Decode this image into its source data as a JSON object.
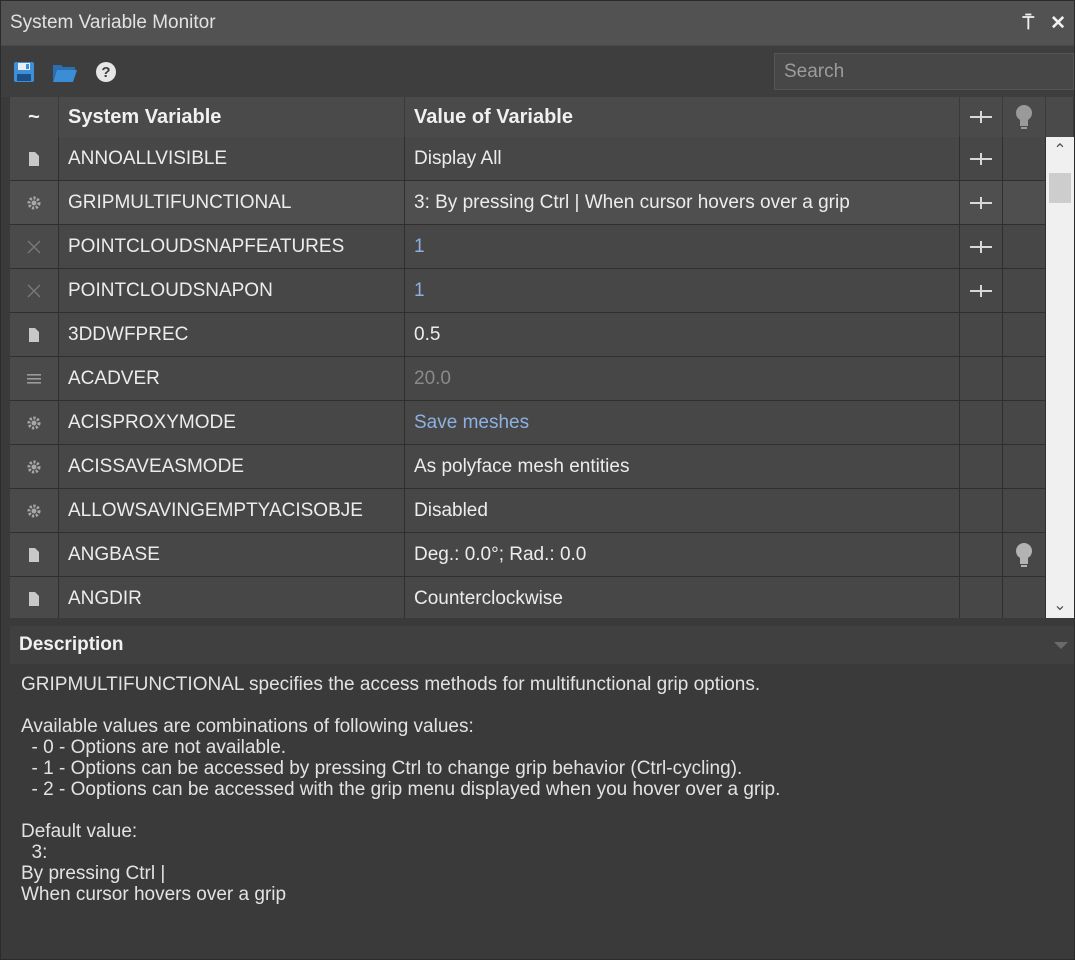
{
  "window": {
    "title": "System Variable Monitor",
    "pin_glyph": "⍑",
    "close_glyph": "✕"
  },
  "toolbar": {
    "icons": [
      "save-icon",
      "open-folder-icon",
      "help-icon"
    ],
    "search_placeholder": "Search"
  },
  "table": {
    "headers": {
      "type": "~",
      "name": "System Variable",
      "value": "Value of Variable"
    },
    "rows": [
      {
        "icon": "document-icon",
        "name": "ANNOALLVISIBLE",
        "value": "Display All",
        "value_style": "normal",
        "pinned": true,
        "tip": false
      },
      {
        "icon": "gear-icon",
        "name": "GRIPMULTIFUNCTIONAL",
        "value": "3: By pressing Ctrl | When cursor hovers over a grip",
        "value_style": "normal",
        "pinned": true,
        "tip": false,
        "selected": true
      },
      {
        "icon": "x-icon",
        "name": "POINTCLOUDSNAPFEATURES",
        "value": "1",
        "value_style": "blue",
        "pinned": true,
        "tip": false
      },
      {
        "icon": "x-icon",
        "name": "POINTCLOUDSNAPON",
        "value": "1",
        "value_style": "blue",
        "pinned": true,
        "tip": false
      },
      {
        "icon": "document-icon",
        "name": "3DDWFPREC",
        "value": "0.5",
        "value_style": "normal",
        "pinned": false,
        "tip": false
      },
      {
        "icon": "list-icon",
        "name": "ACADVER",
        "value": "20.0",
        "value_style": "gray",
        "pinned": false,
        "tip": false
      },
      {
        "icon": "gear-icon",
        "name": "ACISPROXYMODE",
        "value": "Save meshes",
        "value_style": "blue",
        "pinned": false,
        "tip": false
      },
      {
        "icon": "gear-icon",
        "name": "ACISSAVEASMODE",
        "value": "As polyface mesh entities",
        "value_style": "normal",
        "pinned": false,
        "tip": false
      },
      {
        "icon": "gear-icon",
        "name": "ALLOWSAVINGEMPTYACISOBJE",
        "value": "Disabled",
        "value_style": "normal",
        "pinned": false,
        "tip": false
      },
      {
        "icon": "document-icon",
        "name": "ANGBASE",
        "value": "Deg.: 0.0°; Rad.: 0.0",
        "value_style": "normal",
        "pinned": false,
        "tip": true
      },
      {
        "icon": "document-icon",
        "name": "ANGDIR",
        "value": "Counterclockwise",
        "value_style": "normal",
        "pinned": false,
        "tip": false
      }
    ]
  },
  "description": {
    "header": "Description",
    "lines": [
      "GRIPMULTIFUNCTIONAL specifies the access methods for multifunctional grip options.",
      "",
      "Available values are combinations of following values:",
      "  - 0 - Options are not available.",
      "  - 1 - Options can be accessed by pressing Ctrl to change grip behavior (Ctrl-cycling).",
      "  - 2 - Ooptions can be accessed with the grip menu displayed when you hover over a grip.",
      "",
      "Default value:",
      "  3:",
      "By pressing Ctrl |",
      "When cursor hovers over a grip"
    ]
  },
  "colors": {
    "blue_value": "#8db0e2",
    "gray_value": "#8a8a8a",
    "save_icon": "#3d8fd8",
    "folder_icon": "#3b8ed6"
  }
}
